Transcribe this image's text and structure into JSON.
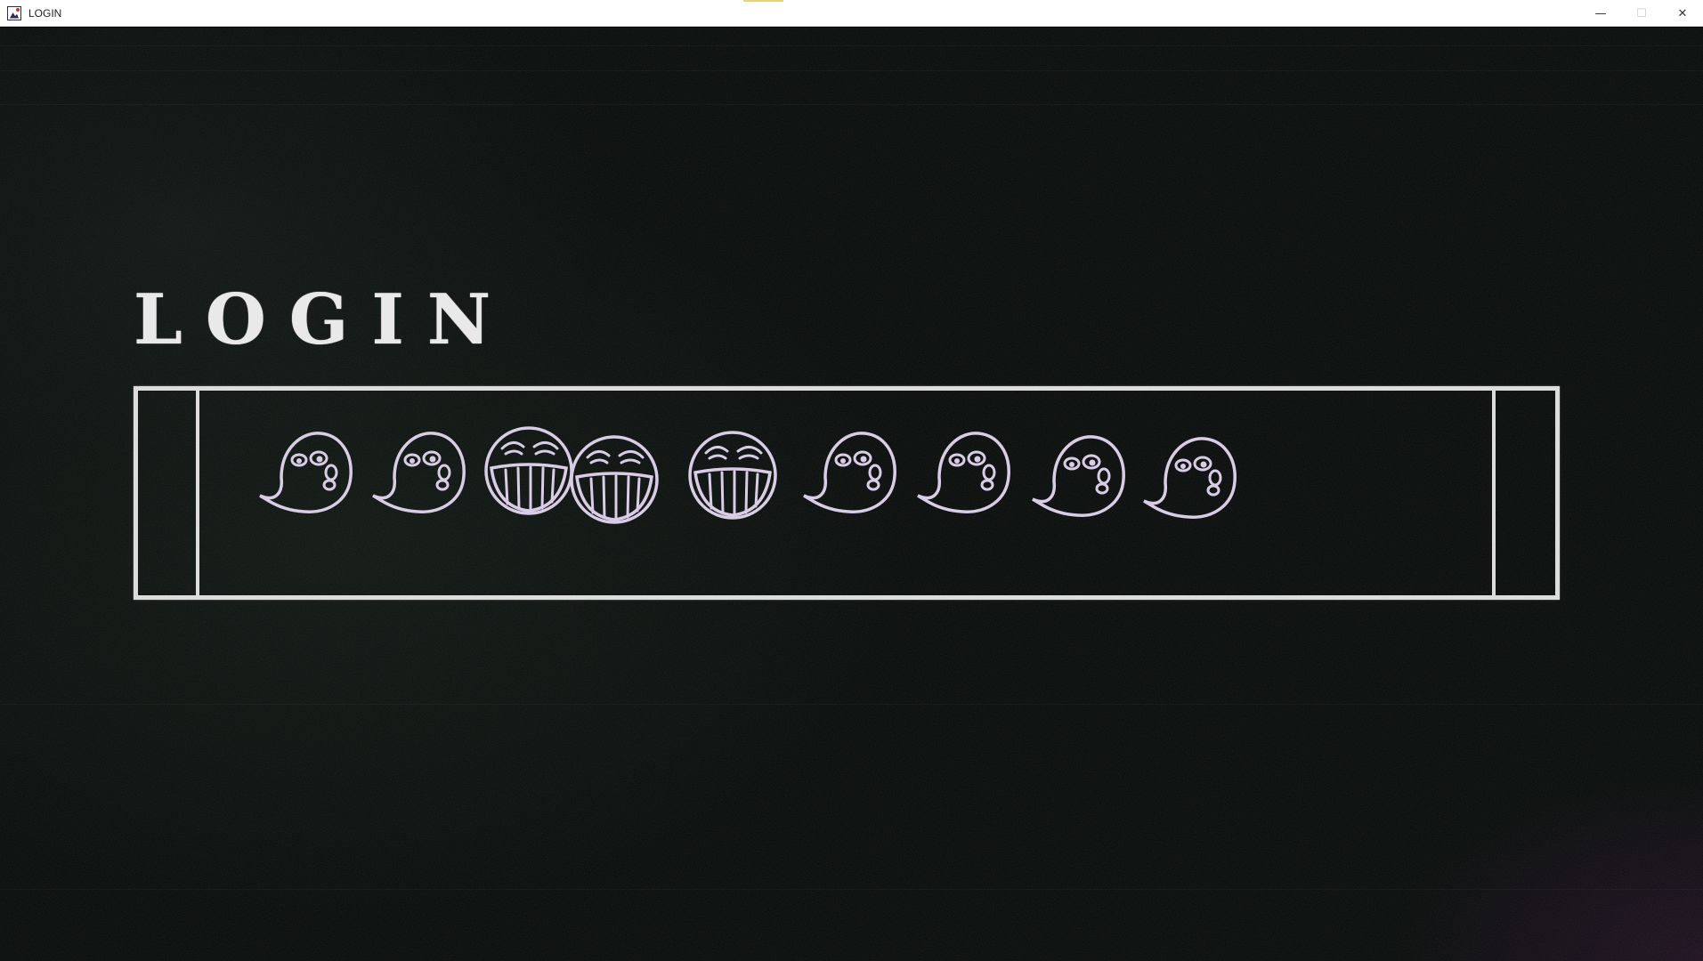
{
  "window": {
    "title": "LOGIN",
    "minimize_symbol": "—",
    "maximize_symbol": "☐",
    "close_symbol": "✕"
  },
  "login": {
    "heading": "LOGIN"
  },
  "password_field": {
    "masking_glyphs": [
      "ghost-face",
      "ghost-face",
      "grin-face",
      "grin-face",
      "grin-face",
      "ghost-face",
      "ghost-face",
      "ghost-face",
      "ghost-face"
    ]
  },
  "colors": {
    "background": "#060908",
    "chalk": "#dcdcdc",
    "glyph_stroke": "#d9cde6"
  }
}
